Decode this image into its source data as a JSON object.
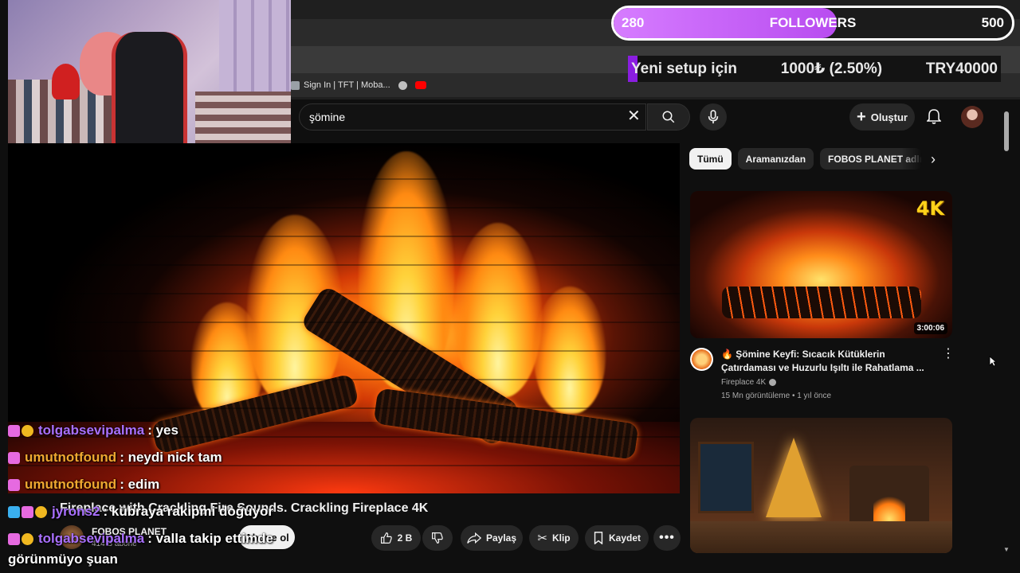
{
  "browser": {
    "bookmarks": [
      {
        "label": "Sign In | TFT | Moba...",
        "icon_color": "#9aa0a6"
      },
      {
        "label": "",
        "icon_color": "#c0c0c0"
      },
      {
        "label": "",
        "icon_color": "#ff0000"
      }
    ],
    "window_controls": {
      "minimize": "—",
      "restore": "❐",
      "close": "✕"
    }
  },
  "followers_goal": {
    "current": "280",
    "label": "FOLLOWERS",
    "target": "500",
    "progress_fraction": 0.56,
    "fill_color": "#c86af8"
  },
  "donation_goal": {
    "label": "Yeni setup için",
    "amount": "1000₺ (2.50%)",
    "target": "TRY40000",
    "progress_fraction": 0.025,
    "accent": "#8a1de0"
  },
  "youtube": {
    "search_query": "şömine",
    "create_label": "Oluştur",
    "chips": [
      {
        "label": "Tümü",
        "active": true
      },
      {
        "label": "Aramanızdan",
        "active": false
      },
      {
        "label": "FOBOS PLANET adlı yük",
        "active": false
      }
    ],
    "video": {
      "title": "Fireplace with Crackling Fire Sounds. Crackling Fireplace 4K",
      "channel": "FOBOS PLANET",
      "subscribers": "414 B abone",
      "subscribe_label": "Abone ol",
      "likes": "2 B",
      "share_label": "Paylaş",
      "clip_label": "Klip",
      "save_label": "Kaydet"
    },
    "recommended": [
      {
        "title": "🔥 Şömine Keyfi: Sıcacık Kütüklerin Çatırdaması ve Huzurlu Işıltı ile Rahatlama ...",
        "channel": "Fireplace 4K",
        "meta": "15 Mn görüntüleme • 1 yıl önce",
        "duration": "3:00:06",
        "badge": "4K"
      },
      {
        "title": "",
        "channel": "",
        "meta": "",
        "duration": ""
      }
    ]
  },
  "chat": [
    {
      "user": "tolgabsevipalma",
      "color": "#a970ff",
      "badges": [
        "sub",
        "gold"
      ],
      "message": ": yes"
    },
    {
      "user": "umutnotfound",
      "color": "#f0a830",
      "badges": [
        "sub"
      ],
      "message": ": neydi nick tam"
    },
    {
      "user": "umutnotfound",
      "color": "#f0a830",
      "badges": [
        "sub"
      ],
      "message": ": edim"
    },
    {
      "user": "jyrons2",
      "color": "#a970ff",
      "badges": [
        "cube",
        "sub",
        "gold"
      ],
      "message": ": kübraya rakipmi doğuyor"
    },
    {
      "user": "tolgabsevipalma",
      "color": "#a970ff",
      "badges": [
        "sub",
        "gold"
      ],
      "message": ": valla takip ettimde"
    }
  ],
  "chat_continuation": "görünmüyo şuan"
}
